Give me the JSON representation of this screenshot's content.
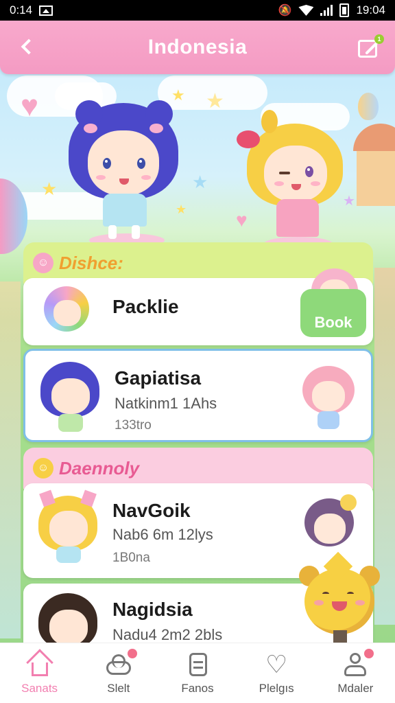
{
  "status_bar": {
    "time": "0:14",
    "clock": "19:04"
  },
  "header": {
    "title": "Indonesia"
  },
  "sections": [
    {
      "label": "Dishce:",
      "color": "#d9f08a"
    },
    {
      "label": "Daennoly",
      "color": "#fbcde0"
    }
  ],
  "cards": [
    {
      "name": "Packlie",
      "button": "Book"
    },
    {
      "name": "Gapiatisa",
      "line1": "Natkinm1 1Ahs",
      "line2": "133tro"
    },
    {
      "name": "NavGoik",
      "line1": "Nab6 6m 12lys",
      "line2": "1B0na"
    },
    {
      "name": "Nagidsia",
      "line1": "Nadu4 2m2 2bls"
    }
  ],
  "nav": {
    "items": [
      {
        "label": "Sanats",
        "icon": "home-icon",
        "active": true
      },
      {
        "label": "Slelt",
        "icon": "cloud-icon",
        "badge": true
      },
      {
        "label": "Fanos",
        "icon": "tablet-icon"
      },
      {
        "label": "Plelgıs",
        "icon": "heart-icon"
      },
      {
        "label": "Mdaler",
        "icon": "profile-icon",
        "badge": true
      }
    ]
  },
  "colors": {
    "primary": "#f49bc3",
    "accent": "#8ed97a",
    "selected_border": "#7fbfe8"
  }
}
